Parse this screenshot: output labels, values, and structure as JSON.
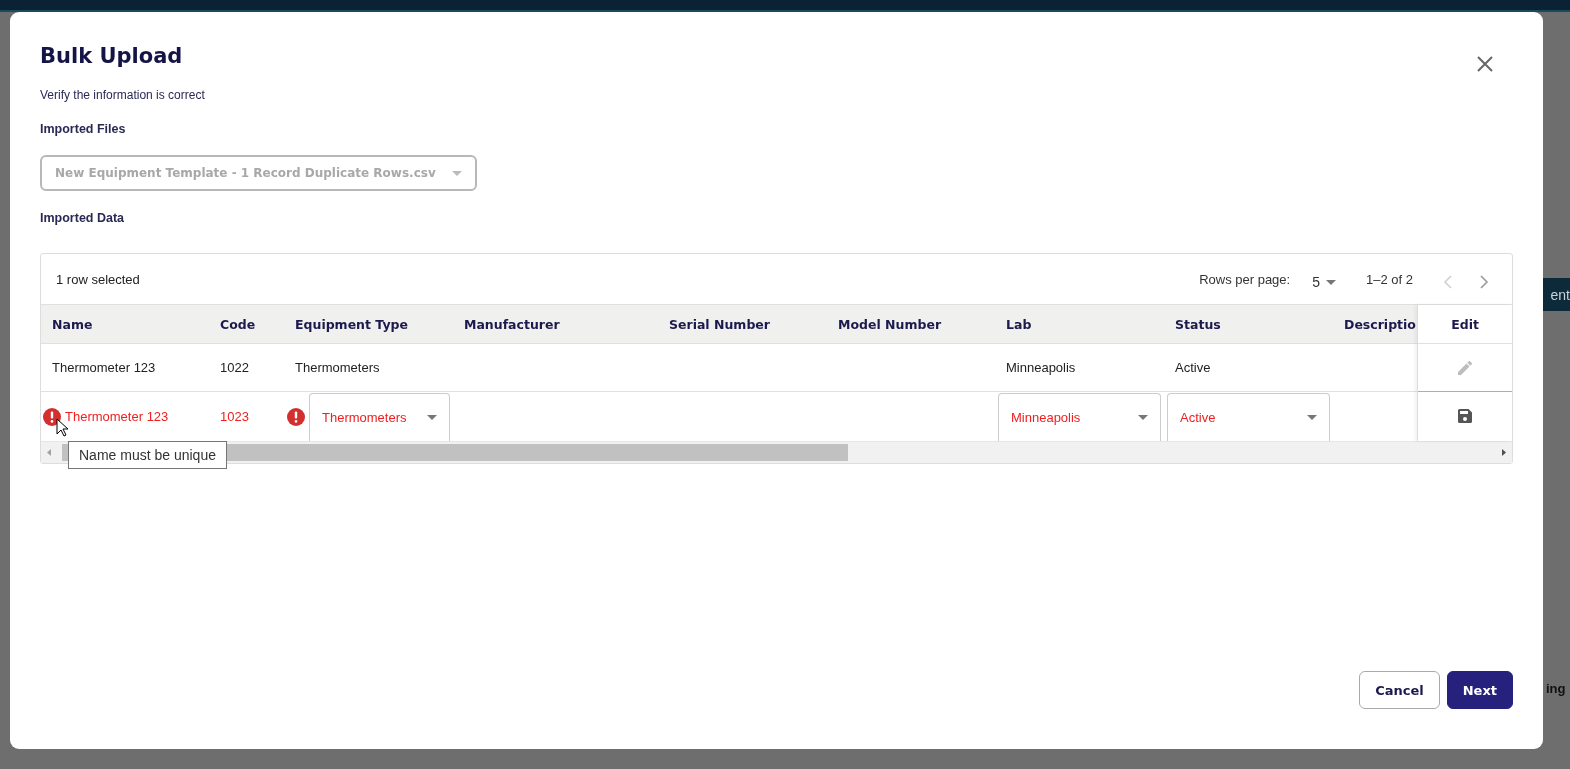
{
  "background": {
    "button_text": "ent",
    "text": "ing"
  },
  "dialog": {
    "title": "Bulk Upload",
    "subtitle": "Verify the information is correct",
    "imported_files": {
      "label": "Imported Files",
      "value": "New Equipment Template - 1 Record Duplicate Rows.csv"
    },
    "imported_data": {
      "label": "Imported Data",
      "tooltip": "Name must be unique",
      "table": {
        "selection_text": "1 row selected",
        "rows_per_page_label": "Rows per page:",
        "rows_per_page": "5",
        "range": "1–2 of 2",
        "prev_disabled": true,
        "next_disabled": false,
        "columns": [
          "Name",
          "Code",
          "Equipment Type",
          "Manufacturer",
          "Serial Number",
          "Model Number",
          "Lab",
          "Status",
          "Descriptio"
        ],
        "edit_column": "Edit",
        "rows": [
          {
            "invalid": false,
            "editing": false,
            "cells": [
              {
                "kind": "text",
                "value": "Thermometer 123",
                "error": false
              },
              {
                "kind": "text",
                "value": "1022",
                "error": false
              },
              {
                "kind": "text",
                "value": "Thermometers",
                "error": false
              },
              {
                "kind": "blank"
              },
              {
                "kind": "blank"
              },
              {
                "kind": "blank"
              },
              {
                "kind": "text",
                "value": "Minneapolis",
                "error": false
              },
              {
                "kind": "text",
                "value": "Active",
                "error": false
              },
              {
                "kind": "blank"
              }
            ]
          },
          {
            "invalid": true,
            "editing": true,
            "cells": [
              {
                "kind": "text",
                "value": "Thermometer 123",
                "error": true
              },
              {
                "kind": "text",
                "value": "1023",
                "error": false
              },
              {
                "kind": "select",
                "value": "Thermometers",
                "error": true
              },
              {
                "kind": "blank"
              },
              {
                "kind": "blank"
              },
              {
                "kind": "blank"
              },
              {
                "kind": "select",
                "value": "Minneapolis",
                "error": false
              },
              {
                "kind": "select",
                "value": "Active",
                "error": false
              },
              {
                "kind": "blank"
              }
            ]
          }
        ]
      }
    },
    "buttons": [
      {
        "label": "Cancel",
        "kind": "secondary"
      },
      {
        "label": "Next",
        "kind": "primary"
      }
    ]
  }
}
